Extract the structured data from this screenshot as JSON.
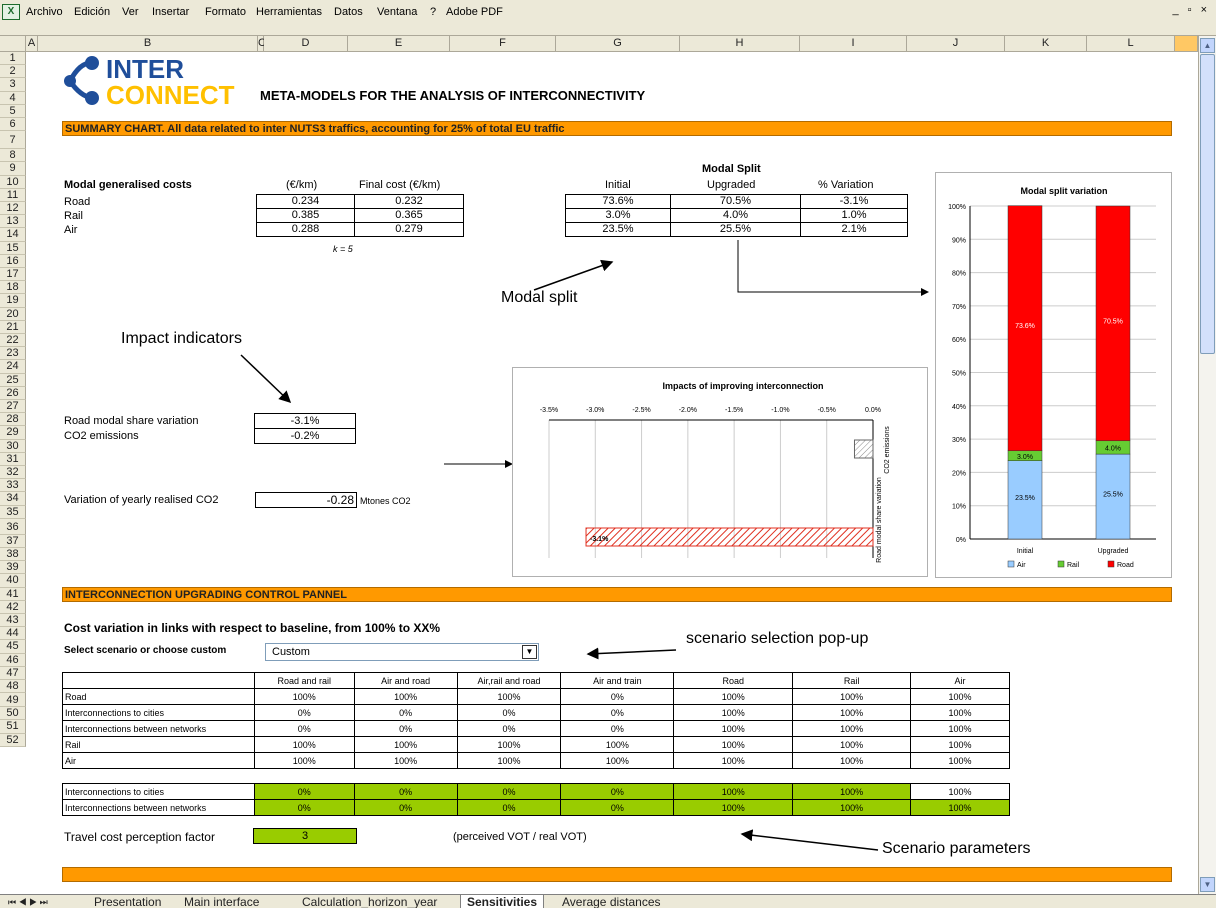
{
  "menu": [
    "Archivo",
    "Edición",
    "Ver",
    "Insertar",
    "Formato",
    "Herramientas",
    "Datos",
    "Ventana",
    "?",
    "Adobe PDF"
  ],
  "window_controls": "_ ▫ ×",
  "columns": [
    "A",
    "B",
    "C",
    "D",
    "E",
    "F",
    "G",
    "H",
    "I",
    "J",
    "K",
    "L"
  ],
  "rows": [
    "1",
    "2",
    "3",
    "4",
    "5",
    "6",
    "7",
    "8",
    "9",
    "10",
    "11",
    "12",
    "13",
    "14",
    "15",
    "16",
    "17",
    "18",
    "19",
    "20",
    "21",
    "22",
    "23",
    "24",
    "25",
    "26",
    "27",
    "28",
    "29",
    "30",
    "31",
    "32",
    "33",
    "34",
    "35",
    "36",
    "37",
    "38",
    "39",
    "40",
    "41",
    "42",
    "43",
    "44",
    "45",
    "46",
    "47",
    "48",
    "49",
    "50",
    "51",
    "52"
  ],
  "logo": {
    "line1": "INTER",
    "line2": "CONNECT"
  },
  "title": "META-MODELS FOR THE  ANALYSIS OF INTERCONNECTIVITY",
  "summary_bar": "SUMMARY CHART.     All data related to inter NUTS3 traffics, accounting for 25% of total EU traffic",
  "costs": {
    "header": "Modal generalised costs",
    "col1": "(€/km)",
    "col2": "Final cost (€/km)",
    "rows": [
      {
        "mode": "Road",
        "initial": "0.234",
        "final": "0.232"
      },
      {
        "mode": "Rail",
        "initial": "0.385",
        "final": "0.365"
      },
      {
        "mode": "Air",
        "initial": "0.288",
        "final": "0.279"
      }
    ],
    "k": "k =   5"
  },
  "split": {
    "title": "Modal Split",
    "headers": [
      "Initial",
      "Upgraded",
      "% Variation"
    ],
    "rows": [
      [
        "73.6%",
        "70.5%",
        "-3.1%"
      ],
      [
        "3.0%",
        "4.0%",
        "1.0%"
      ],
      [
        "23.5%",
        "25.5%",
        "2.1%"
      ]
    ]
  },
  "annotations": {
    "modal_split": "Modal split",
    "impact": "Impact indicators",
    "scenario_popup": "scenario selection pop-up",
    "scenario_params": "Scenario parameters"
  },
  "indicators": {
    "road_label": "Road modal share variation",
    "road_value": "-3.1%",
    "co2_label": "CO2 emissions",
    "co2_value": "-0.2%",
    "yearly_label": "Variation of yearly realised CO2",
    "yearly_value": "-0.28",
    "yearly_unit": "Mtones CO2"
  },
  "control_bar": "INTERCONNECTION UPGRADING CONTROL PANNEL",
  "cost_variation": "Cost variation in links with respect to baseline, from 100% to XX%",
  "select_label": "Select scenario or choose custom",
  "select_value": "Custom",
  "scenario_table": {
    "headers": [
      "Road and rail",
      "Air and road",
      "Air,rail and road",
      "Air and train",
      "Road",
      "Rail",
      "Air"
    ],
    "rows": [
      {
        "label": "Road",
        "values": [
          "100%",
          "100%",
          "100%",
          "0%",
          "100%",
          "100%",
          "100%"
        ]
      },
      {
        "label": "Interconnections to cities",
        "values": [
          "0%",
          "0%",
          "0%",
          "0%",
          "100%",
          "100%",
          "100%"
        ]
      },
      {
        "label": "Interconnections between networks",
        "values": [
          "0%",
          "0%",
          "0%",
          "0%",
          "100%",
          "100%",
          "100%"
        ]
      },
      {
        "label": "Rail",
        "values": [
          "100%",
          "100%",
          "100%",
          "100%",
          "100%",
          "100%",
          "100%"
        ]
      },
      {
        "label": "Air",
        "values": [
          "100%",
          "100%",
          "100%",
          "100%",
          "100%",
          "100%",
          "100%"
        ]
      }
    ]
  },
  "param_table": {
    "rows": [
      {
        "label": "Interconnections to cities",
        "values": [
          "0%",
          "0%",
          "0%",
          "0%",
          "100%",
          "100%",
          "100%"
        ]
      },
      {
        "label": "Interconnections between networks",
        "values": [
          "0%",
          "0%",
          "0%",
          "0%",
          "100%",
          "100%",
          "100%"
        ]
      }
    ]
  },
  "perception": {
    "label": "Travel cost perception factor",
    "value": "3",
    "note": "(perceived VOT / real VOT)"
  },
  "tabs": [
    "Presentation",
    "Main interface",
    "Calculation_horizon_year",
    "Sensitivities",
    "Average distances"
  ],
  "chart_data": [
    {
      "type": "bar",
      "title": "Modal split variation",
      "categories": [
        "Initial",
        "Upgraded"
      ],
      "series": [
        {
          "name": "Air",
          "color": "#99ccff",
          "values": [
            23.5,
            25.5
          ]
        },
        {
          "name": "Rail",
          "color": "#66cc33",
          "values": [
            3.0,
            4.0
          ]
        },
        {
          "name": "Road",
          "color": "#ff0000",
          "values": [
            73.6,
            70.5
          ]
        }
      ],
      "ylim": [
        0,
        100
      ],
      "yticks": [
        "0%",
        "10%",
        "20%",
        "30%",
        "40%",
        "50%",
        "60%",
        "70%",
        "80%",
        "90%",
        "100%"
      ],
      "labels": {
        "air": [
          "23.5%",
          "25.5%"
        ],
        "rail": [
          "3.0%",
          "4.0%"
        ],
        "road": [
          "73.6%",
          "70.5%"
        ]
      },
      "legend": "bottom"
    },
    {
      "type": "bar",
      "title": "Impacts of improving interconnection",
      "categories": [
        "CO2 emissions",
        "Road modal share variation"
      ],
      "values": [
        -0.2,
        -3.1
      ],
      "xticks": [
        "-3.5%",
        "-3.0%",
        "-2.5%",
        "-2.0%",
        "-1.5%",
        "-1.0%",
        "-0.5%",
        "0.0%"
      ],
      "xlim": [
        -3.5,
        0
      ],
      "data_label": "-3.1%"
    }
  ]
}
